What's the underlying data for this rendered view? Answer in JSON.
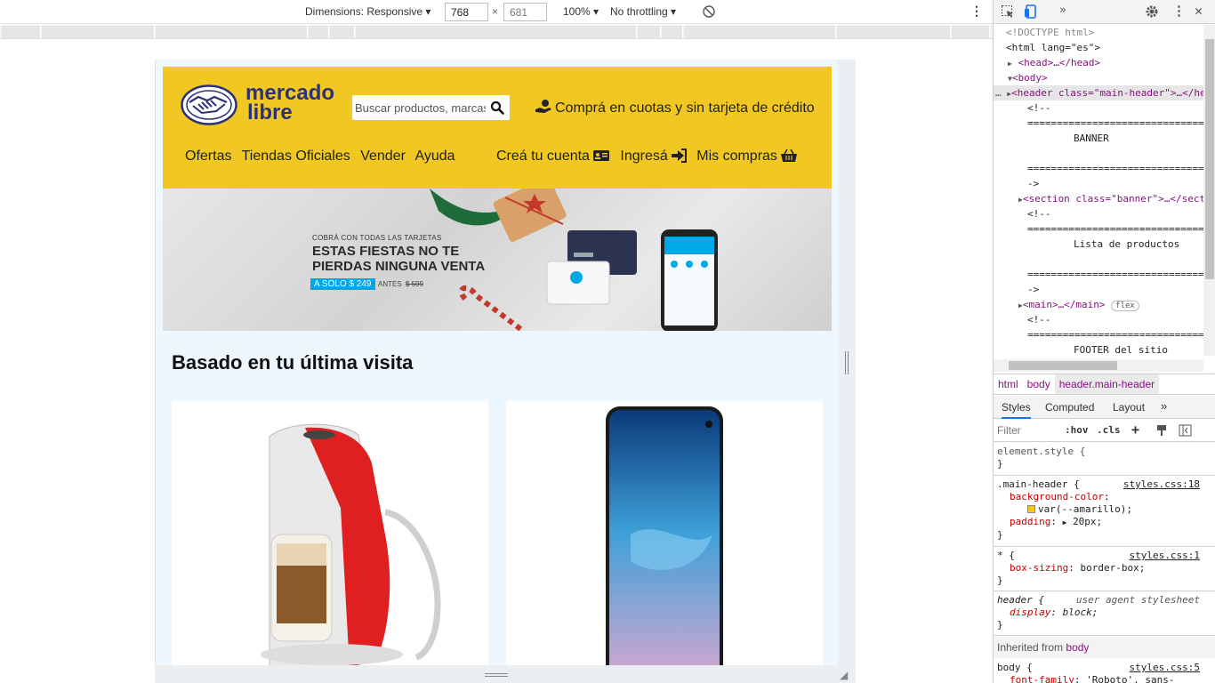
{
  "device_toolbar": {
    "dimensions_label": "Dimensions: Responsive",
    "width_value": "768",
    "height_value": "681",
    "times": "×",
    "zoom": "100%",
    "throttling": "No throttling"
  },
  "page": {
    "logo_line1": "mercado",
    "logo_line2": "libre",
    "search_placeholder": "Buscar productos, marcas y más...",
    "promo_text": "Comprá en cuotas y sin tarjeta de crédito",
    "nav_left": [
      "Ofertas",
      "Tiendas Oficiales",
      "Vender",
      "Ayuda"
    ],
    "nav_right": {
      "create_account": "Creá tu cuenta",
      "login": "Ingresá",
      "my_purchases": "Mis compras"
    },
    "banner": {
      "small": "COBRÁ CON TODAS LAS TARJETAS",
      "line1": "ESTAS FIESTAS NO TE",
      "line2": "PIERDAS NINGUNA VENTA",
      "price": "A SOLO $ 249",
      "before_label": "ANTES",
      "before_price": "$ 599"
    },
    "section_title": "Basado en tu última visita"
  },
  "devtools": {
    "code_lines": [
      {
        "type": "plain",
        "text": "<!DOCTYPE html>"
      },
      {
        "type": "open",
        "text": "<html lang=\"es\">"
      },
      {
        "type": "collapsed",
        "text": "<head>…</head>"
      },
      {
        "type": "expanded",
        "text": "<body>"
      },
      {
        "type": "selected",
        "text": "<header class=\"main-header\">…</header>"
      },
      {
        "type": "comment",
        "text": "<!--"
      },
      {
        "type": "comment",
        "text": "================================"
      },
      {
        "type": "comment",
        "text": "BANNER"
      },
      {
        "type": "comment",
        "text": ""
      },
      {
        "type": "comment",
        "text": "================================"
      },
      {
        "type": "comment",
        "text": "->"
      },
      {
        "type": "collapsed",
        "text": "<section class=\"banner\">…</section>"
      },
      {
        "type": "comment",
        "text": "<!--"
      },
      {
        "type": "comment",
        "text": "================================"
      },
      {
        "type": "comment",
        "text": "Lista de productos"
      },
      {
        "type": "comment",
        "text": ""
      },
      {
        "type": "comment",
        "text": "================================"
      },
      {
        "type": "comment",
        "text": "->"
      },
      {
        "type": "collapsed",
        "text": "<main>…</main>"
      },
      {
        "type": "comment",
        "text": "<!--"
      },
      {
        "type": "comment",
        "text": "================================"
      },
      {
        "type": "comment",
        "text": "FOOTER del sitio"
      }
    ],
    "main_badge": "flex",
    "breadcrumbs": [
      "html",
      "body",
      "header.main-header"
    ],
    "style_tabs": [
      "Styles",
      "Computed",
      "Layout"
    ],
    "filter_placeholder": "Filter",
    "hov": ":hov",
    "cls": ".cls",
    "rules": {
      "element_style": "element.style {",
      "main_header_selector": ".main-header {",
      "main_header_src": "styles.css:18",
      "bg_prop": "background-color",
      "bg_val": "var(--amarillo);",
      "pad_prop": "padding",
      "pad_val": "20px;",
      "star_selector": "* {",
      "star_src": "styles.css:1",
      "box_prop": "box-sizing",
      "box_val": "border-box;",
      "header_selector": "header {",
      "ua_label": "user agent stylesheet",
      "display_prop": "display",
      "display_val": "block;",
      "body_selector": "body {",
      "body_src": "styles.css:5",
      "font_prop": "font-family",
      "font_val": "'Roboto', sans-",
      "close": "}"
    },
    "inherited_label": "Inherited from",
    "inherited_from": "body"
  },
  "colors": {
    "brand_yellow": "#f1c823",
    "brand_navy": "#2d3277",
    "banner_blue": "#00a8e8"
  }
}
